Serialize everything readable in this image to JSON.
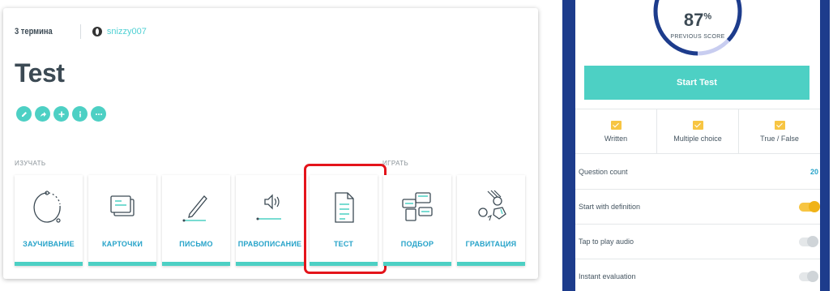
{
  "set": {
    "term_count": "3 термина",
    "username": "snizzy007",
    "title": "Test"
  },
  "actions": [
    "edit-icon",
    "share-icon",
    "add-icon",
    "info-icon",
    "more-icon"
  ],
  "sections": {
    "study": "ИЗУЧАТЬ",
    "play": "ИГРАТЬ"
  },
  "tiles": [
    {
      "label": "ЗАУЧИВАНИЕ"
    },
    {
      "label": "КАРТОЧКИ"
    },
    {
      "label": "ПИСЬМО"
    },
    {
      "label": "ПРАВОПИСАНИЕ"
    },
    {
      "label": "ТЕСТ"
    },
    {
      "label": "ПОДБОР"
    },
    {
      "label": "ГРАВИТАЦИЯ"
    }
  ],
  "colors": {
    "accent": "#4dd0c4",
    "link": "#26a3c9",
    "highlight": "#e4141b",
    "toggle_on": "#f7c543",
    "frame": "#1d3c8c"
  },
  "test_panel": {
    "score": "87",
    "score_unit": "%",
    "score_label": "PREVIOUS SCORE",
    "score_fraction": 0.87,
    "start_label": "Start Test",
    "question_types": [
      {
        "label": "Written",
        "checked": true
      },
      {
        "label": "Multiple choice",
        "checked": true
      },
      {
        "label": "True / False",
        "checked": true
      }
    ],
    "options": [
      {
        "label": "Question count",
        "value": "20"
      },
      {
        "label": "Start with definition",
        "toggle": true
      },
      {
        "label": "Tap to play audio",
        "toggle": false
      },
      {
        "label": "Instant evaluation",
        "toggle": false
      }
    ]
  }
}
